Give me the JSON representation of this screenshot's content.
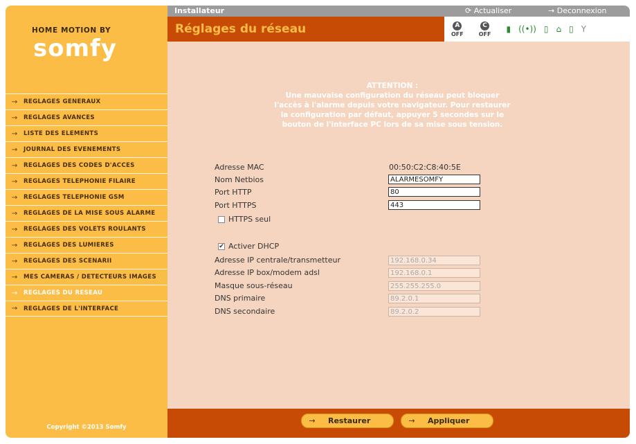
{
  "sidebar": {
    "brand_line": "HOME MOTION BY",
    "brand_name": "somfy",
    "copyright": "Copyright ©2013 Somfy",
    "items": [
      {
        "label": "REGLAGES GENERAUX"
      },
      {
        "label": "REGLAGES AVANCES"
      },
      {
        "label": "LISTE DES ELEMENTS"
      },
      {
        "label": "JOURNAL DES EVENEMENTS"
      },
      {
        "label": "REGLAGES DES CODES D'ACCES"
      },
      {
        "label": "REGLAGES TELEPHONIE FILAIRE"
      },
      {
        "label": "REGLAGES TELEPHONIE GSM"
      },
      {
        "label": "REGLAGES DE LA MISE SOUS ALARME"
      },
      {
        "label": "REGLAGES DES VOLETS ROULANTS"
      },
      {
        "label": "REGLAGES DES LUMIERES"
      },
      {
        "label": "REGLAGES DES SCENARII"
      },
      {
        "label": "MES CAMERAS / DETECTEURS IMAGES"
      },
      {
        "label": "REGLAGES DU RESEAU",
        "active": true
      },
      {
        "label": "REGLAGES DE L'INTERFACE"
      }
    ]
  },
  "topbar": {
    "role": "Installateur",
    "refresh_label": "Actualiser",
    "logout_label": "Deconnexion"
  },
  "titlebar": {
    "title": "Réglages du réseau",
    "zone_a": {
      "letter": "A",
      "state": "OFF"
    },
    "zone_c": {
      "letter": "C",
      "state": "OFF"
    }
  },
  "warning": {
    "heading": "ATTENTION :",
    "text": "Une mauvaise configuration du réseau peut bloquer l'accès à l'alarme depuis votre navigateur. Pour restaurer la configuration par défaut, appuyer 5 secondes sur le bouton de l'interface PC lors de sa mise sous tension."
  },
  "form": {
    "mac_label": "Adresse MAC",
    "mac_value": "00:50:C2:C8:40:5E",
    "netbios_label": "Nom Netbios",
    "netbios_value": "ALARMESOMFY",
    "http_label": "Port HTTP",
    "http_value": "80",
    "https_label": "Port HTTPS",
    "https_value": "443",
    "https_only_label": "HTTPS seul",
    "https_only_checked": false,
    "dhcp_label": "Activer DHCP",
    "dhcp_checked": true,
    "ip_central_label": "Adresse IP centrale/transmetteur",
    "ip_central_value": "192.168.0.34",
    "ip_box_label": "Adresse IP box/modem adsl",
    "ip_box_value": "192.168.0.1",
    "mask_label": "Masque sous-réseau",
    "mask_value": "255.255.255.0",
    "dns1_label": "DNS primaire",
    "dns1_value": "89.2.0.1",
    "dns2_label": "DNS secondaire",
    "dns2_value": "89.2.0.2"
  },
  "actions": {
    "restore_label": "Restaurer",
    "apply_label": "Appliquer"
  },
  "colors": {
    "brand_yellow": "#fbbd45",
    "brand_orange": "#c84b05",
    "content_bg": "#f6d5c0"
  }
}
